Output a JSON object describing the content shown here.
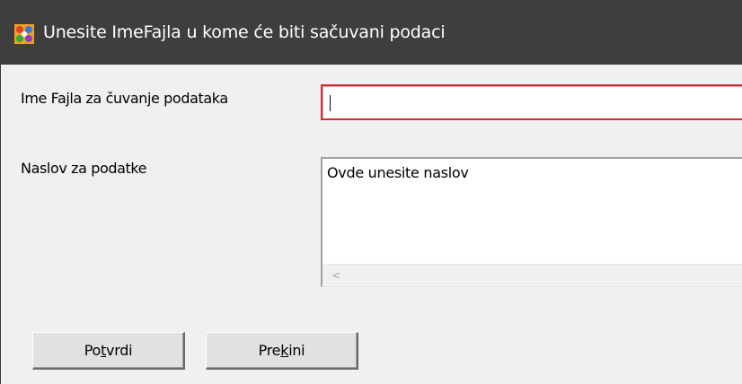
{
  "window": {
    "title": "Unesite ImeFajla u kome će biti sačuvani podaci",
    "icon": "app-icon"
  },
  "form": {
    "filename_label": "Ime Fajla za čuvanje podataka",
    "filename_value": "",
    "title_label": "Naslov za podatke",
    "title_value": "Ovde unesite naslov"
  },
  "buttons": {
    "confirm": {
      "before": "Po",
      "accel": "t",
      "after": "vrdi"
    },
    "cancel": {
      "before": "Pre",
      "accel": "k",
      "after": "ini"
    }
  },
  "colors": {
    "titlebar": "#3e3e3e",
    "focus_border": "#c9303a"
  }
}
